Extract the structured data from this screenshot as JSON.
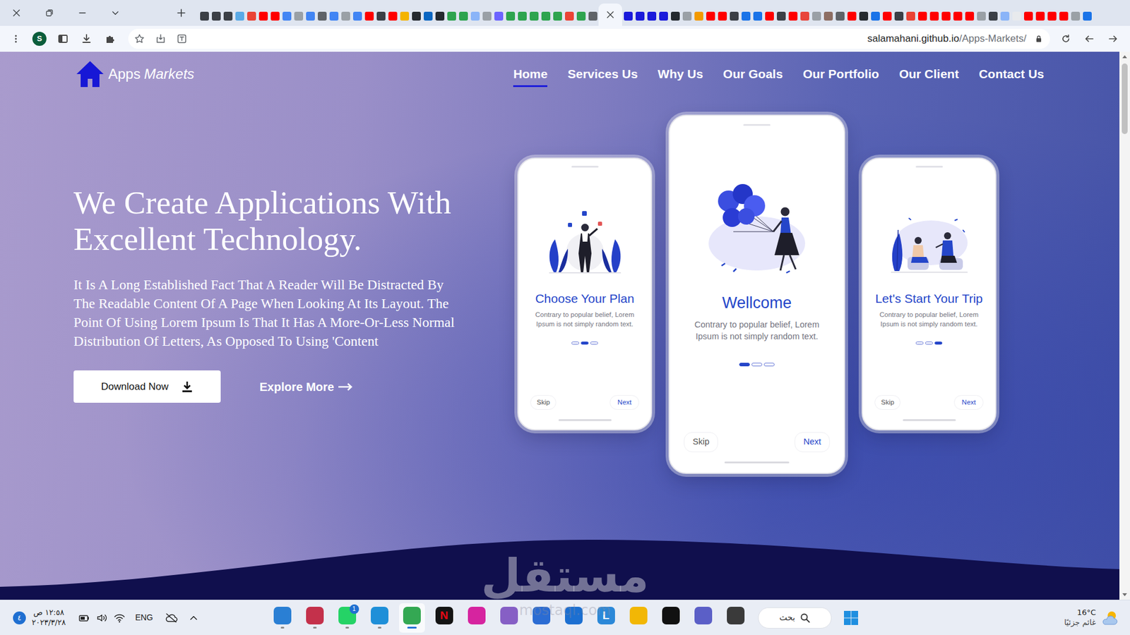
{
  "browser": {
    "tabs": [
      {
        "color": "#3b3f46",
        "selected": false
      },
      {
        "color": "#3b3f46",
        "selected": false
      },
      {
        "color": "#3b3f46",
        "selected": false
      },
      {
        "color": "#5aa9e6",
        "selected": false
      },
      {
        "color": "#ea4335",
        "selected": false
      },
      {
        "color": "#ff0000",
        "selected": false
      },
      {
        "color": "#ff0000",
        "selected": false
      },
      {
        "color": "#4285f4",
        "selected": false
      },
      {
        "color": "#9aa0a6",
        "selected": false
      },
      {
        "color": "#4285f4",
        "selected": false
      },
      {
        "color": "#5f6368",
        "selected": false
      },
      {
        "color": "#4285f4",
        "selected": false
      },
      {
        "color": "#9aa0a6",
        "selected": false
      },
      {
        "color": "#4285f4",
        "selected": false
      },
      {
        "color": "#ff0000",
        "selected": false
      },
      {
        "color": "#3b3f46",
        "selected": false
      },
      {
        "color": "#ff0000",
        "selected": false
      },
      {
        "color": "#f4b400",
        "selected": false
      },
      {
        "color": "#24292f",
        "selected": false
      },
      {
        "color": "#0a66c2",
        "selected": false
      },
      {
        "color": "#24292f",
        "selected": false
      },
      {
        "color": "#2ea44f",
        "selected": false
      },
      {
        "color": "#2ea44f",
        "selected": false
      },
      {
        "color": "#8ab4f8",
        "selected": false
      },
      {
        "color": "#9aa0a6",
        "selected": false
      },
      {
        "color": "#6c63ff",
        "selected": false
      },
      {
        "color": "#2ea44f",
        "selected": false
      },
      {
        "color": "#2ea44f",
        "selected": false
      },
      {
        "color": "#2ea44f",
        "selected": false
      },
      {
        "color": "#2ea44f",
        "selected": false
      },
      {
        "color": "#2ea44f",
        "selected": false
      },
      {
        "color": "#ea4335",
        "selected": false
      },
      {
        "color": "#2ea44f",
        "selected": false
      },
      {
        "color": "#5f6368",
        "selected": false
      },
      {
        "selected": true
      },
      {
        "color": "#1a1adb",
        "selected": false
      },
      {
        "color": "#1a1adb",
        "selected": false
      },
      {
        "color": "#1a1adb",
        "selected": false
      },
      {
        "color": "#1a1adb",
        "selected": false
      },
      {
        "color": "#24292f",
        "selected": false
      },
      {
        "color": "#9aa0a6",
        "selected": false
      },
      {
        "color": "#f29900",
        "selected": false
      },
      {
        "color": "#ff0000",
        "selected": false
      },
      {
        "color": "#ff0000",
        "selected": false
      },
      {
        "color": "#3b3f46",
        "selected": false
      },
      {
        "color": "#1a73e8",
        "selected": false
      },
      {
        "color": "#1a73e8",
        "selected": false
      },
      {
        "color": "#ff0000",
        "selected": false
      },
      {
        "color": "#3b3f46",
        "selected": false
      },
      {
        "color": "#ff0000",
        "selected": false
      },
      {
        "color": "#e8453c",
        "selected": false
      },
      {
        "color": "#9aa0a6",
        "selected": false
      },
      {
        "color": "#8d6e63",
        "selected": false
      },
      {
        "color": "#5f6368",
        "selected": false
      },
      {
        "color": "#ff0000",
        "selected": false
      },
      {
        "color": "#24292f",
        "selected": false
      },
      {
        "color": "#1a73e8",
        "selected": false
      },
      {
        "color": "#ff0000",
        "selected": false
      },
      {
        "color": "#3b3f46",
        "selected": false
      },
      {
        "color": "#ea4335",
        "selected": false
      },
      {
        "color": "#ff0000",
        "selected": false
      },
      {
        "color": "#ff0000",
        "selected": false
      },
      {
        "color": "#ff0000",
        "selected": false
      },
      {
        "color": "#ff0000",
        "selected": false
      },
      {
        "color": "#ff0000",
        "selected": false
      },
      {
        "color": "#9aa0a6",
        "selected": false
      },
      {
        "color": "#3b3f46",
        "selected": false
      },
      {
        "color": "#8ab4f8",
        "selected": false
      },
      {
        "color": "#e8eaed",
        "selected": false
      },
      {
        "color": "#ff0000",
        "selected": false
      },
      {
        "color": "#ff0000",
        "selected": false
      },
      {
        "color": "#ff0000",
        "selected": false
      },
      {
        "color": "#ff0000",
        "selected": false
      },
      {
        "color": "#9aa0a6",
        "selected": false
      },
      {
        "color": "#1a73e8",
        "selected": false
      }
    ],
    "profile": "S",
    "address": {
      "host": "salamahani.github.io",
      "path": "/Apps-Markets/"
    }
  },
  "site": {
    "logo": {
      "first": "Apps",
      "second": "Markets"
    },
    "nav": [
      {
        "label": "Home",
        "selected": true
      },
      {
        "label": "Services Us",
        "selected": false
      },
      {
        "label": "Why Us",
        "selected": false
      },
      {
        "label": "Our Goals",
        "selected": false
      },
      {
        "label": "Our Portfolio",
        "selected": false
      },
      {
        "label": "Our Client",
        "selected": false
      },
      {
        "label": "Contact Us",
        "selected": false
      }
    ],
    "hero": {
      "title": "We Create Applications With Excellent Technology.",
      "text": "It Is A Long Established Fact That A Reader Will Be Distracted By The Readable Content Of A Page When Looking At Its Layout. The Point Of Using Lorem Ipsum Is That It Has A More-Or-Less Normal Distribution Of Letters, As Opposed To Using 'Content",
      "download": "Download Now",
      "explore": "Explore More"
    },
    "phones": [
      {
        "kind": "small",
        "title": "Choose Your Plan",
        "text": "Contrary to popular belief, Lorem Ipsum is not simply random text.",
        "dots": [
          {
            "selected": false
          },
          {
            "selected": true
          },
          {
            "selected": false
          }
        ],
        "skip": "Skip",
        "next": "Next"
      },
      {
        "kind": "large",
        "title": "Wellcome",
        "text": "Contrary to popular belief, Lorem Ipsum is not simply random text.",
        "dots": [
          {
            "selected": true
          },
          {
            "selected": false
          },
          {
            "selected": false
          }
        ],
        "skip": "Skip",
        "next": "Next"
      },
      {
        "kind": "small",
        "title": "Let's Start Your Trip",
        "text": "Contrary to popular belief, Lorem Ipsum is not simply random text.",
        "dots": [
          {
            "selected": false
          },
          {
            "selected": false
          },
          {
            "selected": true
          }
        ],
        "skip": "Skip",
        "next": "Next"
      }
    ]
  },
  "watermark": {
    "arabic": "مستقل",
    "latin": "mostaql.com"
  },
  "taskbar": {
    "notifications": "٤",
    "clock": {
      "time": "١٢:٥٨ ص",
      "date": "٢٠٢٣/٣/٢٨"
    },
    "language": "ENG",
    "apps": [
      {
        "color": "#2a7fd4",
        "running": true,
        "selected": false
      },
      {
        "color": "#c4314b",
        "running": true,
        "selected": false
      },
      {
        "color": "#25d366",
        "running": true,
        "selected": false,
        "badge": "1"
      },
      {
        "color": "#1f8fd8",
        "running": true,
        "selected": false
      },
      {
        "color": "#34a853",
        "running": true,
        "selected": true
      },
      {
        "color": "#141414",
        "glyph": "N",
        "glyph_color": "#e50914",
        "running": false,
        "selected": false
      },
      {
        "color": "#d6249f",
        "running": false,
        "selected": false
      },
      {
        "color": "#865fc5",
        "running": false,
        "selected": false
      },
      {
        "color": "#2b6cd3",
        "running": false,
        "selected": false
      },
      {
        "color": "#1c6fd1",
        "running": false,
        "selected": false
      },
      {
        "color": "#2b88d8",
        "glyph": "L",
        "glyph_color": "#ffffff",
        "running": false,
        "selected": false
      },
      {
        "color": "#f2b705",
        "running": false,
        "selected": false
      },
      {
        "color": "#111111",
        "running": false,
        "selected": false
      },
      {
        "color": "#5b5fc7",
        "running": false,
        "selected": false
      },
      {
        "color": "#3a3a3a",
        "running": false,
        "selected": false
      }
    ],
    "search": "بحث",
    "weather": {
      "temp": "16°C",
      "text": "غائم جزئيًا"
    }
  }
}
